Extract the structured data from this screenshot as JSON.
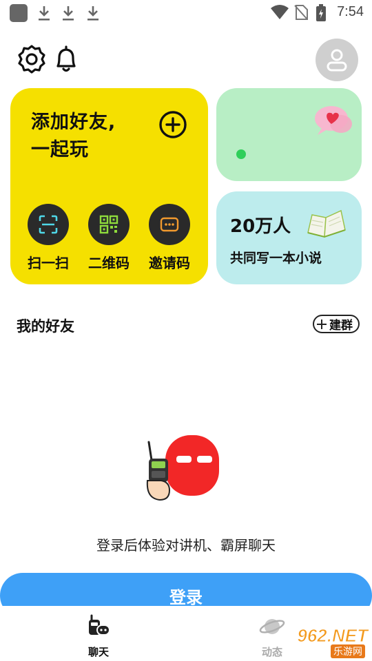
{
  "status_bar": {
    "time": "7:54"
  },
  "header": {
    "settings_icon": "gear-icon",
    "notification_icon": "bell-icon",
    "avatar_icon": "user-icon"
  },
  "add_friend_card": {
    "title_line1": "添加好友,",
    "title_line2": "一起玩",
    "actions": [
      {
        "label": "扫一扫",
        "icon": "scan-icon"
      },
      {
        "label": "二维码",
        "icon": "qrcode-icon"
      },
      {
        "label": "邀请码",
        "icon": "invite-code-icon"
      }
    ]
  },
  "green_card": {
    "icon": "heart-bubble-icon"
  },
  "novel_card": {
    "title": "20万人",
    "subtitle": "共同写一本小说",
    "icon": "book-icon"
  },
  "friends": {
    "title": "我的好友",
    "create_group_label": "建群"
  },
  "empty_state": {
    "message": "登录后体验对讲机、霸屏聊天"
  },
  "login_button": {
    "label": "登录"
  },
  "bottom_nav": {
    "items": [
      {
        "label": "聊天",
        "icon": "walkie-talkie-icon"
      },
      {
        "label": "动态",
        "icon": "planet-icon"
      }
    ]
  },
  "watermark": {
    "brand": "962.NET",
    "sub": "乐游网"
  },
  "colors": {
    "yellow_card": "#f5e000",
    "green_card": "#b8eec5",
    "cyan_card": "#bdeced",
    "login_blue": "#3ea0f7",
    "accent_green": "#2fcf5a"
  }
}
